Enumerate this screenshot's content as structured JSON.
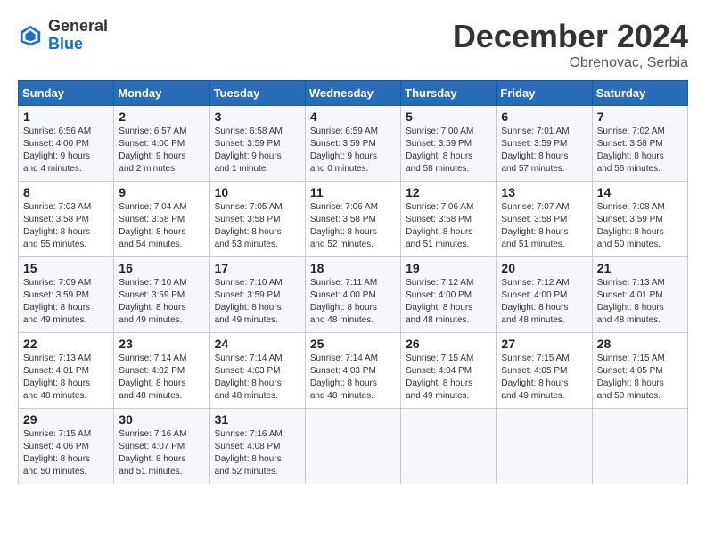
{
  "header": {
    "logo_general": "General",
    "logo_blue": "Blue",
    "month_title": "December 2024",
    "subtitle": "Obrenovac, Serbia"
  },
  "weekdays": [
    "Sunday",
    "Monday",
    "Tuesday",
    "Wednesday",
    "Thursday",
    "Friday",
    "Saturday"
  ],
  "weeks": [
    [
      {
        "day": "1",
        "detail": "Sunrise: 6:56 AM\nSunset: 4:00 PM\nDaylight: 9 hours\nand 4 minutes."
      },
      {
        "day": "2",
        "detail": "Sunrise: 6:57 AM\nSunset: 4:00 PM\nDaylight: 9 hours\nand 2 minutes."
      },
      {
        "day": "3",
        "detail": "Sunrise: 6:58 AM\nSunset: 3:59 PM\nDaylight: 9 hours\nand 1 minute."
      },
      {
        "day": "4",
        "detail": "Sunrise: 6:59 AM\nSunset: 3:59 PM\nDaylight: 9 hours\nand 0 minutes."
      },
      {
        "day": "5",
        "detail": "Sunrise: 7:00 AM\nSunset: 3:59 PM\nDaylight: 8 hours\nand 58 minutes."
      },
      {
        "day": "6",
        "detail": "Sunrise: 7:01 AM\nSunset: 3:59 PM\nDaylight: 8 hours\nand 57 minutes."
      },
      {
        "day": "7",
        "detail": "Sunrise: 7:02 AM\nSunset: 3:58 PM\nDaylight: 8 hours\nand 56 minutes."
      }
    ],
    [
      {
        "day": "8",
        "detail": "Sunrise: 7:03 AM\nSunset: 3:58 PM\nDaylight: 8 hours\nand 55 minutes."
      },
      {
        "day": "9",
        "detail": "Sunrise: 7:04 AM\nSunset: 3:58 PM\nDaylight: 8 hours\nand 54 minutes."
      },
      {
        "day": "10",
        "detail": "Sunrise: 7:05 AM\nSunset: 3:58 PM\nDaylight: 8 hours\nand 53 minutes."
      },
      {
        "day": "11",
        "detail": "Sunrise: 7:06 AM\nSunset: 3:58 PM\nDaylight: 8 hours\nand 52 minutes."
      },
      {
        "day": "12",
        "detail": "Sunrise: 7:06 AM\nSunset: 3:58 PM\nDaylight: 8 hours\nand 51 minutes."
      },
      {
        "day": "13",
        "detail": "Sunrise: 7:07 AM\nSunset: 3:58 PM\nDaylight: 8 hours\nand 51 minutes."
      },
      {
        "day": "14",
        "detail": "Sunrise: 7:08 AM\nSunset: 3:59 PM\nDaylight: 8 hours\nand 50 minutes."
      }
    ],
    [
      {
        "day": "15",
        "detail": "Sunrise: 7:09 AM\nSunset: 3:59 PM\nDaylight: 8 hours\nand 49 minutes."
      },
      {
        "day": "16",
        "detail": "Sunrise: 7:10 AM\nSunset: 3:59 PM\nDaylight: 8 hours\nand 49 minutes."
      },
      {
        "day": "17",
        "detail": "Sunrise: 7:10 AM\nSunset: 3:59 PM\nDaylight: 8 hours\nand 49 minutes."
      },
      {
        "day": "18",
        "detail": "Sunrise: 7:11 AM\nSunset: 4:00 PM\nDaylight: 8 hours\nand 48 minutes."
      },
      {
        "day": "19",
        "detail": "Sunrise: 7:12 AM\nSunset: 4:00 PM\nDaylight: 8 hours\nand 48 minutes."
      },
      {
        "day": "20",
        "detail": "Sunrise: 7:12 AM\nSunset: 4:00 PM\nDaylight: 8 hours\nand 48 minutes."
      },
      {
        "day": "21",
        "detail": "Sunrise: 7:13 AM\nSunset: 4:01 PM\nDaylight: 8 hours\nand 48 minutes."
      }
    ],
    [
      {
        "day": "22",
        "detail": "Sunrise: 7:13 AM\nSunset: 4:01 PM\nDaylight: 8 hours\nand 48 minutes."
      },
      {
        "day": "23",
        "detail": "Sunrise: 7:14 AM\nSunset: 4:02 PM\nDaylight: 8 hours\nand 48 minutes."
      },
      {
        "day": "24",
        "detail": "Sunrise: 7:14 AM\nSunset: 4:03 PM\nDaylight: 8 hours\nand 48 minutes."
      },
      {
        "day": "25",
        "detail": "Sunrise: 7:14 AM\nSunset: 4:03 PM\nDaylight: 8 hours\nand 48 minutes."
      },
      {
        "day": "26",
        "detail": "Sunrise: 7:15 AM\nSunset: 4:04 PM\nDaylight: 8 hours\nand 49 minutes."
      },
      {
        "day": "27",
        "detail": "Sunrise: 7:15 AM\nSunset: 4:05 PM\nDaylight: 8 hours\nand 49 minutes."
      },
      {
        "day": "28",
        "detail": "Sunrise: 7:15 AM\nSunset: 4:05 PM\nDaylight: 8 hours\nand 50 minutes."
      }
    ],
    [
      {
        "day": "29",
        "detail": "Sunrise: 7:15 AM\nSunset: 4:06 PM\nDaylight: 8 hours\nand 50 minutes."
      },
      {
        "day": "30",
        "detail": "Sunrise: 7:16 AM\nSunset: 4:07 PM\nDaylight: 8 hours\nand 51 minutes."
      },
      {
        "day": "31",
        "detail": "Sunrise: 7:16 AM\nSunset: 4:08 PM\nDaylight: 8 hours\nand 52 minutes."
      },
      {
        "day": "",
        "detail": ""
      },
      {
        "day": "",
        "detail": ""
      },
      {
        "day": "",
        "detail": ""
      },
      {
        "day": "",
        "detail": ""
      }
    ]
  ]
}
